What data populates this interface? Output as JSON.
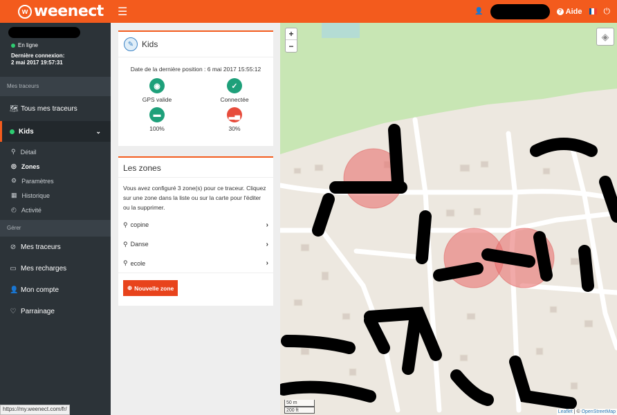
{
  "topbar": {
    "logo_text": "weenect",
    "help_label": "Aide",
    "menu_icon": "hamburger-icon",
    "power_icon": "power-icon"
  },
  "sidebar": {
    "status": "En ligne",
    "last_connection_label": "Dernière connexion:",
    "last_connection_value": "2 mai 2017 19:57:31",
    "section_trackers": "Mes traceurs",
    "all_trackers": "Tous mes traceurs",
    "tracker_name": "Kids",
    "sub_items": [
      "Détail",
      "Zones",
      "Paramètres",
      "Historique",
      "Activité"
    ],
    "section_manage": "Gérer",
    "manage_items": [
      "Mes traceurs",
      "Mes recharges",
      "Mon compte",
      "Parrainage"
    ]
  },
  "status_url": "https://my.weenect.com/fr/",
  "tracker_card": {
    "name": "Kids",
    "last_position": "Date de la dernière position : 6 mai 2017 15:55:12",
    "gps": "GPS valide",
    "connection": "Connectée",
    "battery": "100%",
    "signal": "30%"
  },
  "zones_card": {
    "title": "Les zones",
    "description": "Vous avez configuré 3 zone(s) pour ce traceur. Cliquez sur une zone dans la liste ou sur la carte pour l'éditer ou la supprimer.",
    "zones": [
      "copine",
      "Danse",
      "ecole"
    ],
    "new_zone_button": "Nouvelle zone"
  },
  "map": {
    "zoom_in": "+",
    "zoom_out": "−",
    "scale_m": "50 m",
    "scale_ft": "200 ft",
    "attribution_leaflet": "Leaflet",
    "attribution_sep": " | © ",
    "attribution_osm": "OpenStreetMap"
  },
  "colors": {
    "brand": "#f35b1d",
    "sidebar": "#2c3338",
    "zone_fill": "#e8716f",
    "status_green": "#1ea07a"
  }
}
